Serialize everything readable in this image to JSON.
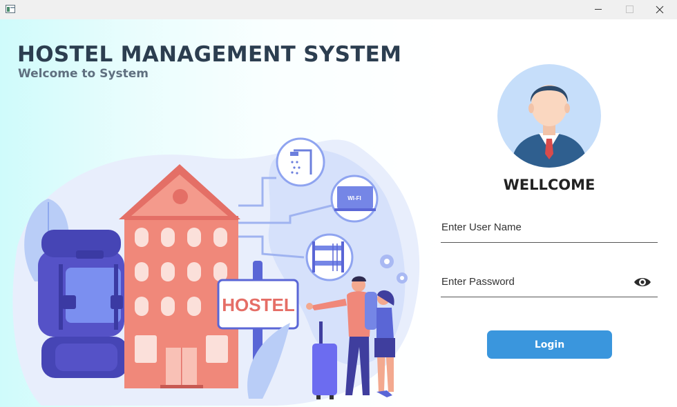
{
  "window": {
    "app_icon": "app-window-icon",
    "controls": [
      "minimize-icon",
      "maximize-icon",
      "close-icon"
    ]
  },
  "header": {
    "title": "HOSTEL MANAGEMENT SYSTEM",
    "subtitle": "Welcome to System"
  },
  "illustration": {
    "sign_text": "HOSTEL",
    "wifi_label": "WI-FI",
    "icons": [
      "shower-icon",
      "wifi-laptop-icon",
      "bunk-bed-icon",
      "gear-icon",
      "gear-icon"
    ]
  },
  "login": {
    "avatar_icon": "user-avatar-icon",
    "welcome_text": "WELLCOME",
    "username_placeholder": "Enter User Name",
    "username_value": "",
    "password_placeholder": "Enter Password",
    "password_value": "",
    "show_password_icon": "eye-icon",
    "login_label": "Login"
  },
  "colors": {
    "title": "#2c3e50",
    "subtitle": "#5f6f7f",
    "accent": "#3a96dd",
    "building": "#f0887a",
    "backpack": "#5552c7",
    "left_gradient_start": "#cffbfb"
  }
}
